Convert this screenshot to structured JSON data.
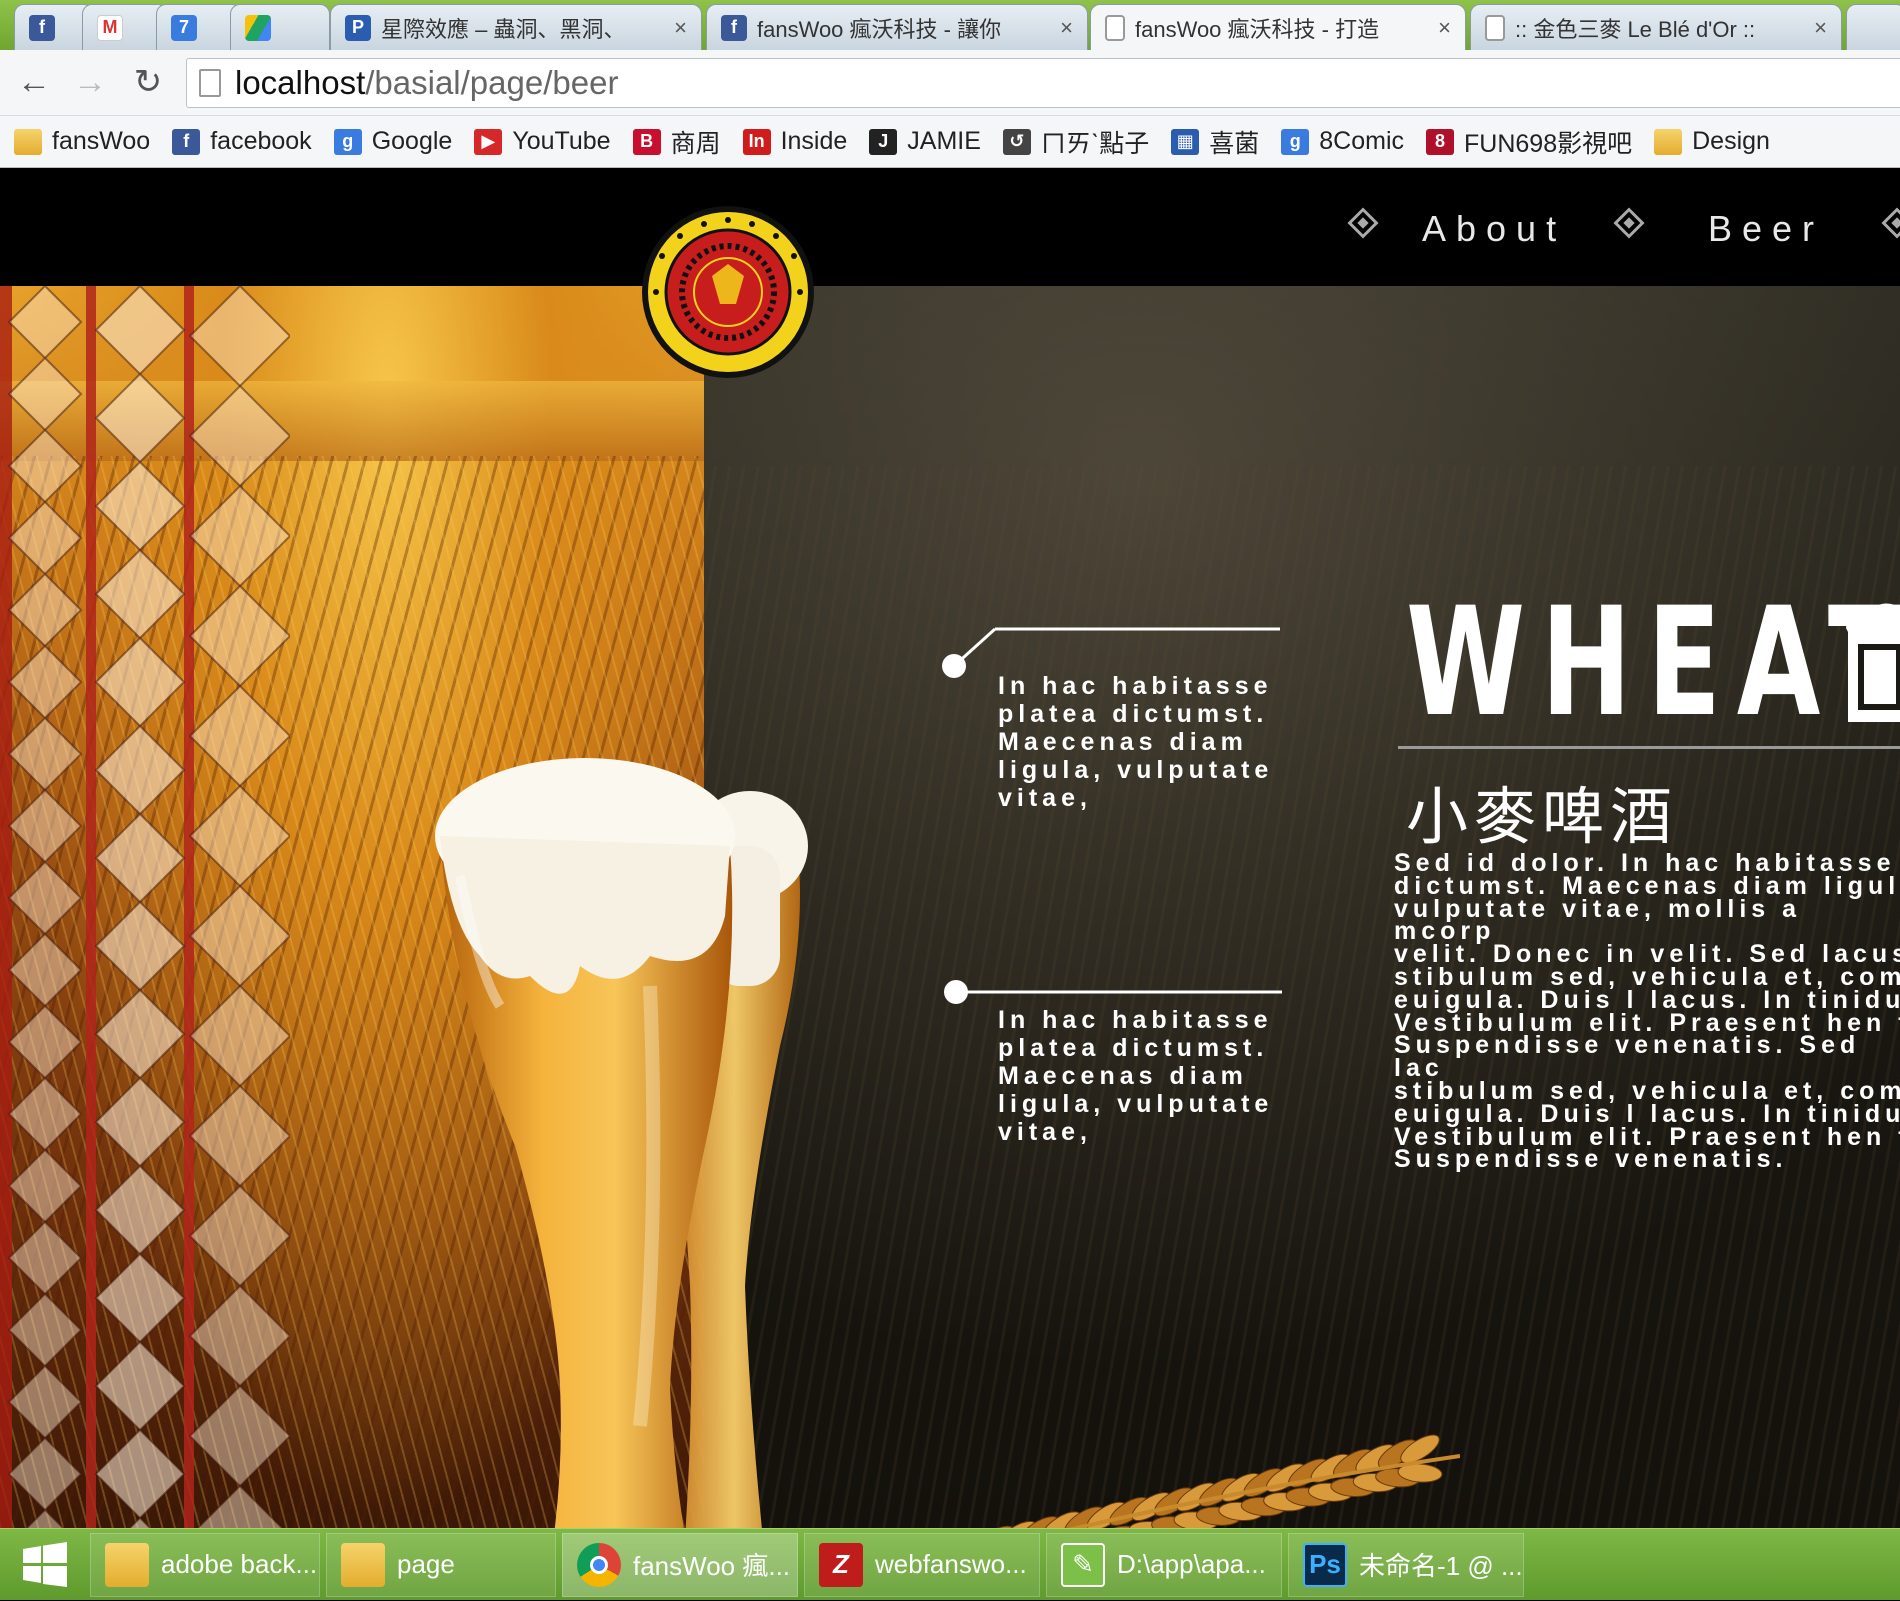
{
  "browser": {
    "tabs": [
      {
        "icon": "facebook-icon",
        "title": "",
        "close": ""
      },
      {
        "icon": "gmail-icon",
        "title": "",
        "close": ""
      },
      {
        "icon": "calendar-icon",
        "title": "",
        "close": ""
      },
      {
        "icon": "google-drive-icon",
        "title": "",
        "close": ""
      },
      {
        "icon": "page-icon",
        "title": "星際效應 – 蟲洞、黑洞、",
        "close": "×"
      },
      {
        "icon": "facebook-icon",
        "title": "fansWoo 瘋沃科技 - 讓你",
        "close": "×"
      },
      {
        "icon": "page-icon",
        "title": "fansWoo 瘋沃科技 - 打造",
        "close": "×"
      },
      {
        "icon": "page-icon",
        "title": ":: 金色三麥 Le Blé d'Or ::",
        "close": "×"
      }
    ],
    "nav": {
      "back": "←",
      "forward": "→",
      "reload": "↻"
    },
    "address": {
      "host": "localhost",
      "path": "/basial/page/beer"
    },
    "bookmarks": [
      {
        "label": "fansWoo",
        "icon": "folder-icon"
      },
      {
        "label": "facebook",
        "icon": "facebook-icon",
        "glyph": "f",
        "color": "#3b5998"
      },
      {
        "label": "Google",
        "icon": "google-plus-icon",
        "glyph": "g",
        "color": "#3a7be0"
      },
      {
        "label": "YouTube",
        "icon": "youtube-icon",
        "glyph": "▶",
        "color": "#d62828"
      },
      {
        "label": "商周",
        "icon": "business-weekly-icon",
        "glyph": "B",
        "color": "#c8102e"
      },
      {
        "label": "Inside",
        "icon": "inside-icon",
        "glyph": "In",
        "color": "#d01c1c"
      },
      {
        "label": "JAMIE",
        "icon": "jamie-icon",
        "glyph": "J",
        "color": "#222222"
      },
      {
        "label": "ㄇㄞˋ點子",
        "icon": "swirl-icon",
        "glyph": "↺",
        "color": "#444444"
      },
      {
        "label": "喜菌",
        "icon": "grid-icon",
        "glyph": "▦",
        "color": "#2a5db0"
      },
      {
        "label": "8Comic",
        "icon": "comic-icon",
        "glyph": "g",
        "color": "#3a7be0"
      },
      {
        "label": "FUN698影視吧",
        "icon": "fun698-icon",
        "glyph": "8",
        "color": "#b0102a"
      },
      {
        "label": "Design",
        "icon": "folder-icon"
      }
    ]
  },
  "site": {
    "nav": [
      {
        "label": "About"
      },
      {
        "label": "Beer"
      }
    ],
    "logo_alt": "Basial Craft Beer logo",
    "callouts": [
      {
        "text": "In hac habitasse\nplatea dictumst.\nMaecenas diam\nligula, vulputate\nvitae,"
      },
      {
        "text": "In hac habitasse\nplatea dictumst.\nMaecenas diam\nligula, vulputate\nvitae,"
      }
    ],
    "title": "WHEAT",
    "subtitle": "小麥啤酒",
    "body": "Sed id dolor. In hac habitasse\ndictumst. Maecenas diam ligul\nvulputate vitae, mollis a mcorp\nvelit. Donec in velit. Sed lacus\nstibulum sed, vehicula et, com\neuigula. Duis l lacus. In tinidu\nVestibulum elit. Praesent hen t\nSuspendisse venenatis. Sed lac\nstibulum sed, vehicula et, com\neuigula. Duis l lacus. In tinidu\nVestibulum elit. Praesent hen t\nSuspendisse venenatis.",
    "colors": {
      "accent": "#e9a12c",
      "nav_bg": "#000000",
      "text": "#ffffff"
    }
  },
  "taskbar": {
    "items": [
      {
        "label": "adobe back...",
        "icon": "folder-icon"
      },
      {
        "label": "page",
        "icon": "folder-icon"
      },
      {
        "label": "fansWoo 瘋...",
        "icon": "chrome-icon",
        "active": true
      },
      {
        "label": "webfanswo...",
        "icon": "filezilla-icon"
      },
      {
        "label": "D:\\app\\apa...",
        "icon": "notepad-icon"
      },
      {
        "label": "未命名-1 @ ...",
        "icon": "photoshop-icon"
      }
    ]
  }
}
